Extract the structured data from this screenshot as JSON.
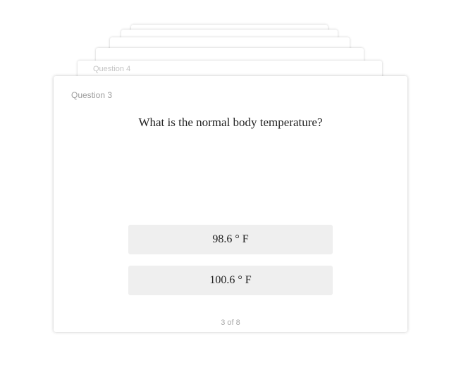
{
  "stack": {
    "behind_label": "Question 4"
  },
  "card": {
    "question_number": "Question 3",
    "question_text": "What is the normal body temperature?",
    "answers": [
      {
        "label": "98.6 ° F"
      },
      {
        "label": "100.6 ° F"
      }
    ],
    "progress": "3 of 8"
  }
}
